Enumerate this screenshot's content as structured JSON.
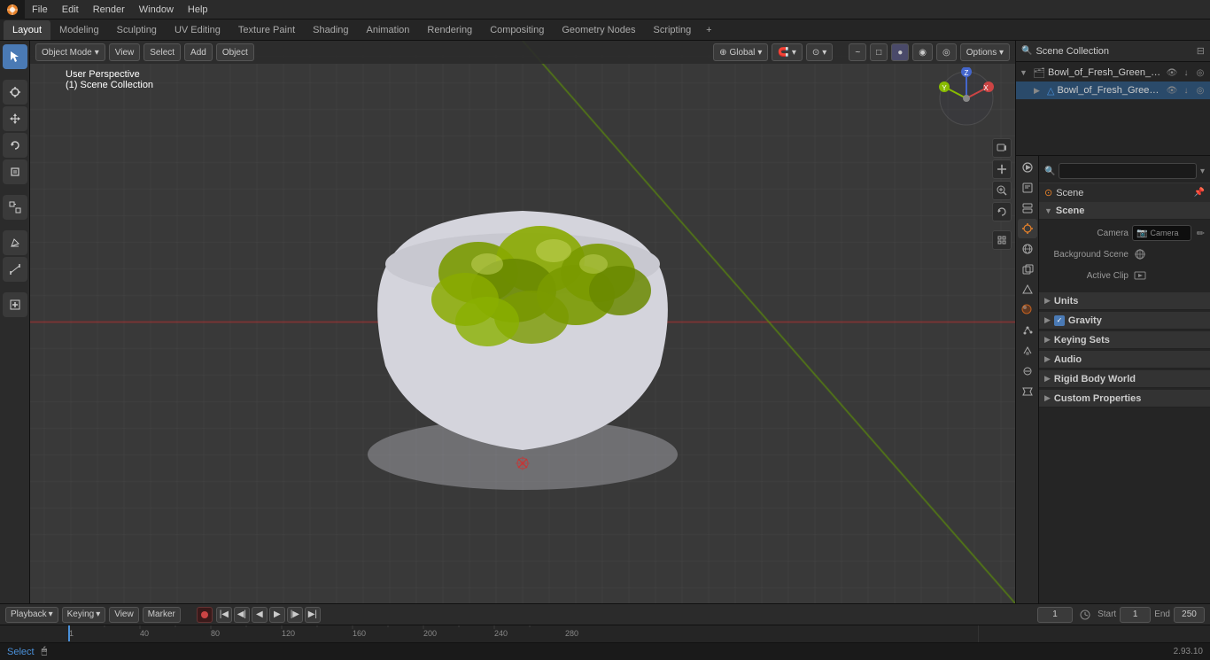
{
  "app": {
    "title": "Blender",
    "version": "2.93.10"
  },
  "menu": {
    "items": [
      "File",
      "Edit",
      "Render",
      "Window",
      "Help"
    ]
  },
  "workspace_tabs": {
    "tabs": [
      "Layout",
      "Modeling",
      "Sculpting",
      "UV Editing",
      "Texture Paint",
      "Shading",
      "Animation",
      "Rendering",
      "Compositing",
      "Geometry Nodes",
      "Scripting"
    ],
    "active": "Layout"
  },
  "header_bar": {
    "mode": "Object Mode",
    "view": "View",
    "select": "Select",
    "add": "Add",
    "object": "Object",
    "transform": "Global",
    "options": "Options ▾"
  },
  "viewport": {
    "info_line1": "User Perspective",
    "info_line2": "(1) Scene Collection"
  },
  "outliner": {
    "title": "Scene Collection",
    "items": [
      {
        "name": "Bowl_of_Fresh_Green_Olives",
        "icon": "🗂",
        "depth": 0,
        "has_children": true
      },
      {
        "name": "Bowl_of_Fresh_Green_Ol",
        "icon": "△",
        "depth": 1,
        "has_children": false
      }
    ]
  },
  "properties": {
    "active_tab": "scene",
    "tabs": [
      "render",
      "output",
      "view_layer",
      "scene",
      "world",
      "object",
      "mesh",
      "material",
      "particles",
      "physics",
      "constraints",
      "modifiers",
      "data"
    ],
    "scene_section": {
      "title": "Scene",
      "camera_label": "Camera",
      "camera_value": "",
      "background_scene_label": "Background Scene",
      "active_clip_label": "Active Clip"
    },
    "units_section": "Units",
    "gravity_section": "Gravity",
    "gravity_checked": true,
    "keying_sets_section": "Keying Sets",
    "audio_section": "Audio",
    "rigid_body_world_section": "Rigid Body World",
    "custom_properties_section": "Custom Properties"
  },
  "timeline": {
    "playback_label": "Playback",
    "keying_label": "Keying",
    "view_label": "View",
    "marker_label": "Marker",
    "frame_current": "1",
    "start_label": "Start",
    "start_value": "1",
    "end_label": "End",
    "end_value": "250",
    "ruler_marks": [
      "1",
      "40",
      "80",
      "120",
      "160",
      "200",
      "240",
      "280"
    ]
  },
  "status_bar": {
    "left": "Select",
    "version": "2.93.10"
  },
  "colors": {
    "accent_blue": "#4a7ab5",
    "accent_orange": "#e5812a",
    "grid_bg": "#393939",
    "viewport_bg": "#393939",
    "axis_x": "#cc3333",
    "axis_y": "#6aaa00",
    "axis_z": "#3366cc"
  }
}
